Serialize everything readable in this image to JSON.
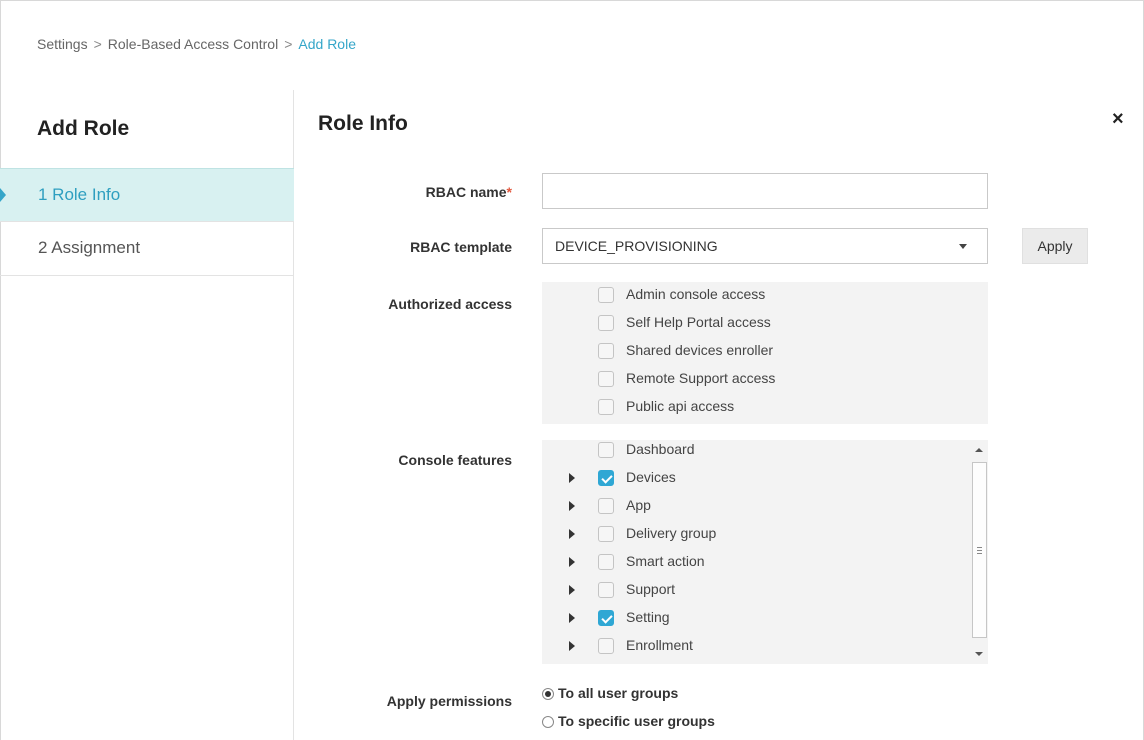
{
  "breadcrumb": {
    "items": [
      "Settings",
      "Role-Based Access Control"
    ],
    "separator": ">",
    "current": "Add Role"
  },
  "sidebar": {
    "title": "Add Role",
    "steps": [
      {
        "label": "1  Role Info",
        "active": true
      },
      {
        "label": "2  Assignment",
        "active": false
      }
    ]
  },
  "main": {
    "title": "Role Info",
    "close_icon": "×"
  },
  "form": {
    "rbac_name": {
      "label": "RBAC name",
      "required_mark": "*",
      "value": ""
    },
    "rbac_template": {
      "label": "RBAC template",
      "selected": "DEVICE_PROVISIONING",
      "apply_label": "Apply"
    },
    "authorized_access": {
      "label": "Authorized access",
      "options": [
        {
          "label": "Admin console access",
          "checked": false
        },
        {
          "label": "Self Help Portal access",
          "checked": false
        },
        {
          "label": "Shared devices enroller",
          "checked": false
        },
        {
          "label": "Remote Support access",
          "checked": false
        },
        {
          "label": "Public api access",
          "checked": false
        }
      ]
    },
    "console_features": {
      "label": "Console features",
      "items": [
        {
          "label": "Dashboard",
          "checked": false,
          "expandable": false
        },
        {
          "label": "Devices",
          "checked": true,
          "expandable": true
        },
        {
          "label": "App",
          "checked": false,
          "expandable": true
        },
        {
          "label": "Delivery group",
          "checked": false,
          "expandable": true
        },
        {
          "label": "Smart action",
          "checked": false,
          "expandable": true
        },
        {
          "label": "Support",
          "checked": false,
          "expandable": true
        },
        {
          "label": "Setting",
          "checked": true,
          "expandable": true
        },
        {
          "label": "Enrollment",
          "checked": false,
          "expandable": true
        }
      ]
    },
    "apply_permissions": {
      "label": "Apply permissions",
      "options": [
        {
          "label": "To all user groups",
          "selected": true
        },
        {
          "label": "To specific user groups",
          "selected": false
        }
      ]
    }
  },
  "colors": {
    "accent": "#35a6c9",
    "active_step_bg": "#d8f1f1",
    "checkbox_checked": "#2fa7d4",
    "required": "#e2583e"
  }
}
